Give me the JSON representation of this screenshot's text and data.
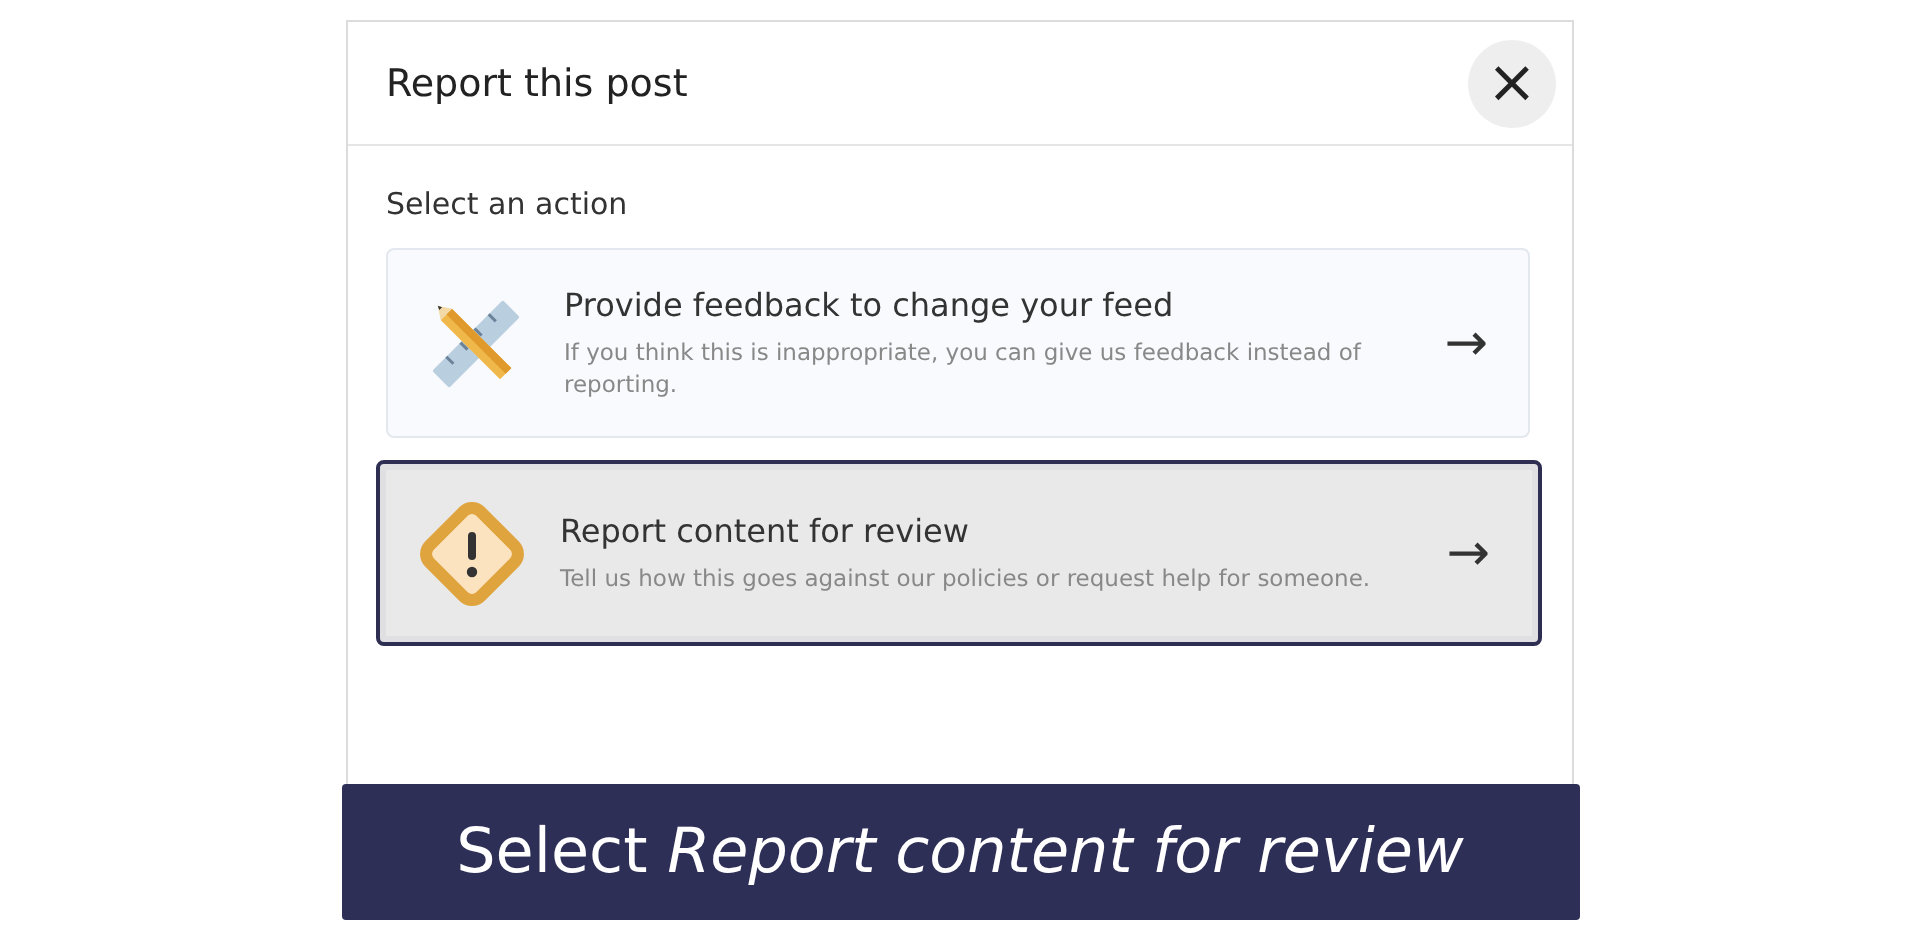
{
  "dialog": {
    "title": "Report this post",
    "close": "×",
    "section_label": "Select an action",
    "options": [
      {
        "kind": "tools",
        "title": "Provide feedback to change your feed",
        "description": "If you think this is inappropriate, you can give us feedback instead of reporting.",
        "arrow": "→",
        "selected": false
      },
      {
        "kind": "warning",
        "title": "Report content for review",
        "description": "Tell us how this goes against our policies or request help for someone.",
        "arrow": "→",
        "selected": true
      }
    ]
  },
  "caption": "Select *Report content for review*"
}
